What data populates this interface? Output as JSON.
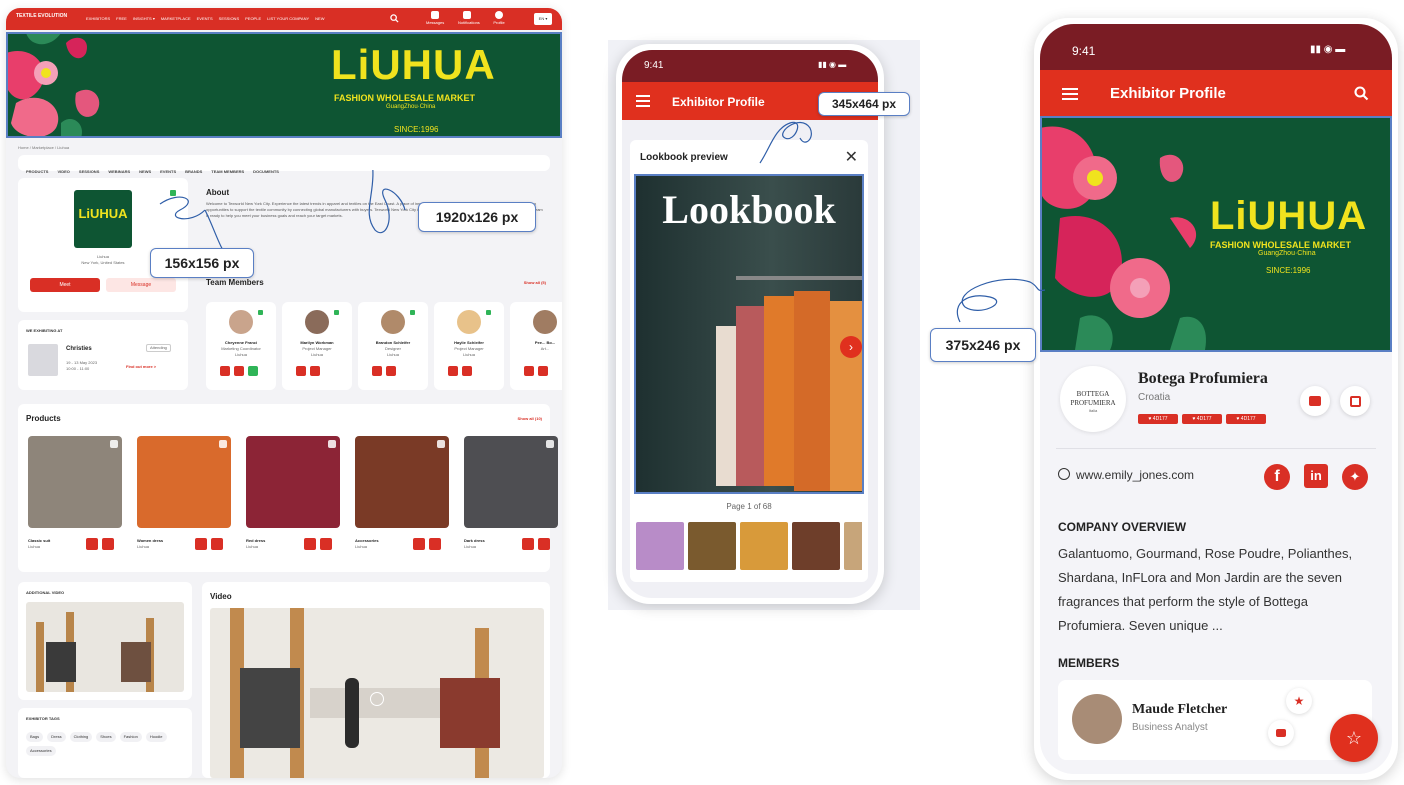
{
  "desktop": {
    "nav": {
      "logo": "TEXTILE EVOLUTION",
      "menu": [
        "EXHIBITORS",
        "FREE",
        "INSIGHTS ▾",
        "MARKETPLACE",
        "EVENTS",
        "SESSIONS",
        "PEOPLE",
        "LIST YOUR COMPANY",
        "NEW"
      ],
      "icons": [
        {
          "label": "Messages",
          "icon": "message-icon"
        },
        {
          "label": "Notifications",
          "icon": "bell-icon"
        },
        {
          "label": "Profile",
          "icon": "avatar"
        }
      ],
      "lang": "EN ▾"
    },
    "banner": {
      "brand": "LiUHUA",
      "subtitle": "FASHION WHOLESALE MARKET",
      "subtitle2": "GuangZhou·China",
      "since": "SINCE:1996"
    },
    "breadcrumb": "Home / Marketplace / Liuhua",
    "tabs": [
      "PRODUCTS",
      "VIDEO",
      "SESSIONS",
      "WEBINARS",
      "NEWS",
      "EVENTS",
      "BRANDS",
      "TEAM MEMBERS",
      "DOCUMENTS"
    ],
    "profile": {
      "name": "Liuhua",
      "location": "New York, United States",
      "meet": "Meet",
      "message": "Message"
    },
    "about": {
      "title": "About",
      "text": "Welcome to Texworld New York City. Experience the latest trends in apparel and textiles on the East Coast. A place of inspiration for designers, buyers, and industry professionals, offering opportunities to support the textile community by connecting global manufacturers with buyers. Texworld New York City is your key to stay relevant in the US market – and the world. Our team is ready to help you meet your business goals and reach your target markets."
    },
    "exhibiting": {
      "title": "WE EXHIBITING AT",
      "name": "Christies",
      "status": "Attending",
      "dates": "19 - 13 May 2023",
      "time": "10:00 - 11:00",
      "link": "Find out more >"
    },
    "team": {
      "title": "Team Members",
      "show_all": "Show all (5)",
      "members": [
        {
          "name": "Cheyenne Franci",
          "role": "Marketing Coordinator",
          "company": "Liuhua",
          "color": "#c9a48c"
        },
        {
          "name": "Marilyn Workman",
          "role": "Project Manager",
          "company": "Liuhua",
          "color": "#8a6b5a"
        },
        {
          "name": "Brandon Schleifer",
          "role": "Designer",
          "company": "Liuhua",
          "color": "#b08a6a"
        },
        {
          "name": "Haylie Schleifer",
          "role": "Project Manager",
          "company": "Liuhua",
          "color": "#e8c28a"
        },
        {
          "name": "Pee... Bo...",
          "role": "Art...",
          "company": "",
          "color": "#a07c62"
        }
      ]
    },
    "products": {
      "title": "Products",
      "show_all": "Show all (10)",
      "items": [
        {
          "name": "Classic suit",
          "company": "Liuhua",
          "color": "#8e857a"
        },
        {
          "name": "Women dress",
          "company": "Liuhua",
          "color": "#d96a2c"
        },
        {
          "name": "Red dress",
          "company": "Liuhua",
          "color": "#8c2436"
        },
        {
          "name": "Accessories",
          "company": "Liuhua",
          "color": "#7a3a26"
        },
        {
          "name": "Dark dress",
          "company": "Liuhua",
          "color": "#4e4e52"
        }
      ]
    },
    "additional_video": {
      "title": "ADDITIONAL VIDEO"
    },
    "video": {
      "title": "Video"
    },
    "exhibitor_tags": {
      "title": "EXHIBITOR TAGS",
      "tags": [
        "Bags",
        "Dress",
        "Clothing",
        "Shoes",
        "Fashion",
        "Hoodie",
        "Accessories"
      ]
    }
  },
  "phone1": {
    "time": "9:41",
    "title": "Exhibitor Profile",
    "modal_title": "Lookbook preview",
    "lookbook_title": "Lookbook",
    "page": "Page 1 of 68",
    "thumbs": [
      "#b88cc8",
      "#7a5a2e",
      "#d89a3a",
      "#6e3e2a",
      "#c7a57a"
    ]
  },
  "phone2": {
    "time": "9:41",
    "title": "Exhibitor Profile",
    "brand": "LiUHUA",
    "subtitle": "FASHION WHOLESALE MARKET",
    "subtitle2": "GuangZhou·China",
    "since": "SINCE:1996",
    "company": "Botega Profumiera",
    "country": "Croatia",
    "logo_text": "BOTTEGA PROFUMIERA",
    "logo_sub": "Italia",
    "chips": [
      "♥ 4D177",
      "♥ 4D177",
      "♥ 4D177"
    ],
    "website": "www.emily_jones.com",
    "overview_title": "COMPANY OVERVIEW",
    "overview": "Galantuomo, Gourmand, Rose Poudre, Polianthes, Shardana, InFLora and Mon Jardin are the seven fragrances that perform the style of Bottega Profumiera. Seven unique ...",
    "members_title": "MEMBERS",
    "member_name": "Maude Fletcher",
    "member_role": "Business Analyst"
  },
  "annotations": {
    "banner_size": "1920x126 px",
    "logo_size": "156x156 px",
    "lookbook_size": "345x464 px",
    "mobile_banner_size": "375x246 px"
  },
  "colors": {
    "brand_red": "#d92f25",
    "banner_green": "#0e5533",
    "brand_yellow": "#f0e31e",
    "annotation_blue": "#5a7fc4"
  }
}
